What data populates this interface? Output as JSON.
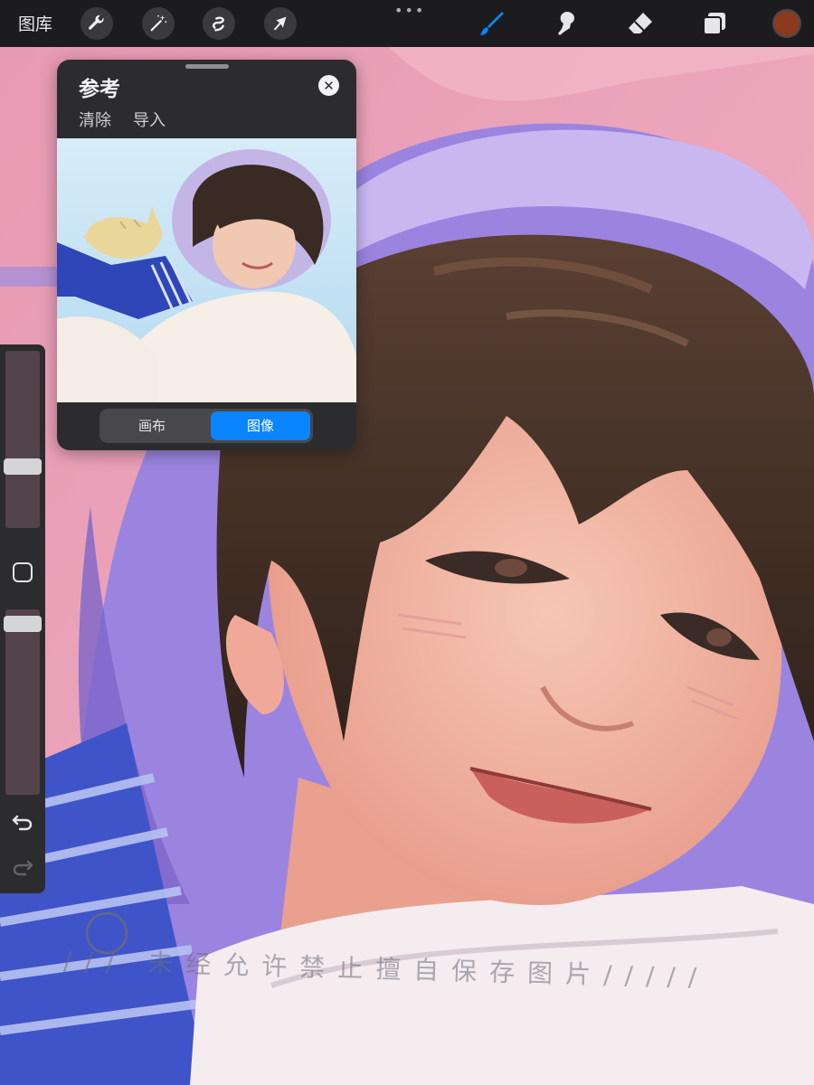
{
  "topbar": {
    "gallery_label": "图库",
    "left_tools": [
      "wrench-icon",
      "magic-wand-icon",
      "selection-icon",
      "transform-arrow-icon"
    ],
    "right_tools": [
      "brush-icon",
      "smudge-icon",
      "eraser-icon",
      "layers-icon"
    ],
    "active_tool": "brush-icon",
    "current_color": "#8b3a1e"
  },
  "reference": {
    "title": "参考",
    "actions": {
      "clear": "清除",
      "import": "导入"
    },
    "segments": {
      "canvas": "画布",
      "image": "图像"
    },
    "active_segment": "image"
  },
  "sidebar": {
    "brush_size_level": 0.33,
    "opacity_level": 0.96
  },
  "watermark": "/// 未经允许禁止擅自保存图片/////"
}
